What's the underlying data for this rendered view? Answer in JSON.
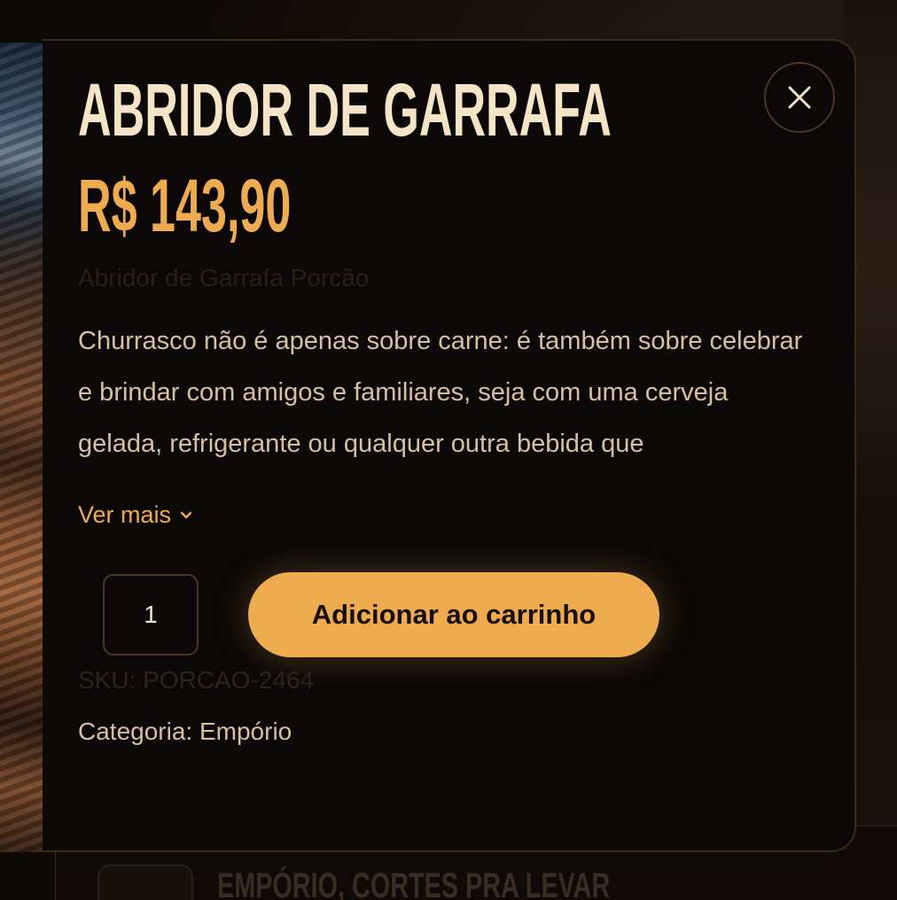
{
  "product": {
    "title": "ABRIDOR DE GARRAFA",
    "price": "R$ 143,90",
    "subtitle": "Abridor de Garrafa Porcão",
    "description": "Churrasco não é apenas sobre carne: é também sobre celebrar e brindar com amigos e familiares, seja com uma cerveja gelada, refrigerante ou qualquer outra bebida que",
    "see_more_label": "Ver mais",
    "quantity": "1",
    "add_to_cart_label": "Adicionar ao carrinho",
    "sku_label": "SKU:",
    "sku_value": "PORCAO-2464",
    "category_label": "Categoria:",
    "category_value": "Empório"
  },
  "background": {
    "section_title": "EMPÓRIO, CORTES PRA LEVAR"
  },
  "icons": {
    "close": "close-icon",
    "see_more": "chevron-down-icon"
  },
  "colors": {
    "accent": "#eeac4e",
    "title": "#f6e4c7",
    "text": "#d9c09d",
    "modal_bg": "#0b0807"
  }
}
